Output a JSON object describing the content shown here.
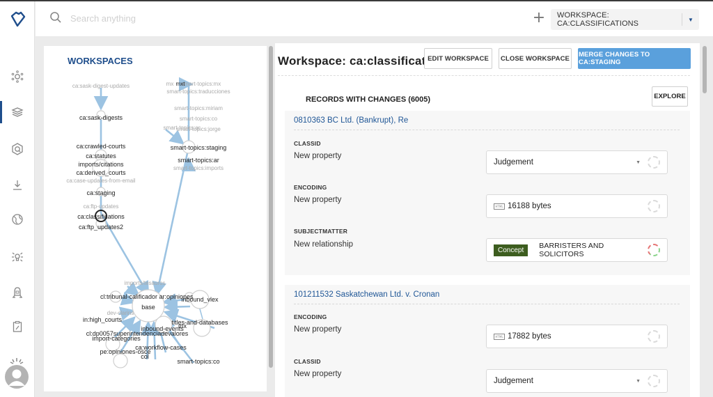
{
  "header": {
    "search_placeholder": "Search anything",
    "add_label": "+",
    "workspace_select": "WORKSPACE: CA:CLASSIFICATIONS"
  },
  "sidebar": {
    "items": [
      {
        "icon": "graph-nodes-icon",
        "active": false
      },
      {
        "icon": "layers-icon",
        "active": true
      },
      {
        "icon": "hexagon-search-icon",
        "active": false
      },
      {
        "icon": "download-icon",
        "active": false
      },
      {
        "icon": "globe-icon",
        "active": false
      },
      {
        "icon": "bulb-idea-icon",
        "active": false
      },
      {
        "icon": "robot-icon",
        "active": false
      },
      {
        "icon": "clipboard-edit-icon",
        "active": false
      }
    ]
  },
  "workspaces_panel": {
    "title": "WORKSPACES",
    "nodes": [
      {
        "label": "ca:sask-digest-updates",
        "muted": true
      },
      {
        "label": "ca:sask-digests",
        "muted": false
      },
      {
        "label": "ca:crawled-courts",
        "muted": false
      },
      {
        "label": "ca:statutes",
        "muted": false
      },
      {
        "label": "imports/citations",
        "muted": false
      },
      {
        "label": "ca:derived_courts",
        "muted": false
      },
      {
        "label": "ca:case-updates-from-email",
        "muted": true
      },
      {
        "label": "ca:staging",
        "muted": false
      },
      {
        "label": "ca:ftp-updates",
        "muted": true
      },
      {
        "label": "ca:classifications",
        "muted": false,
        "selected": true
      },
      {
        "label": "ca:ftp_updates2",
        "muted": false
      },
      {
        "label": "mx",
        "muted": true
      },
      {
        "label": "mxt",
        "muted": false
      },
      {
        "label": "smart-topics:mx",
        "muted": true
      },
      {
        "label": "smart-topics:traducciones",
        "muted": true
      },
      {
        "label": "smart-topics:miriam",
        "muted": true
      },
      {
        "label": "smart-topics:co",
        "muted": true
      },
      {
        "label": "smart-topics:ar",
        "muted": true
      },
      {
        "label": "smart-topics:jorge",
        "muted": true
      },
      {
        "label": "smart-topics:staging",
        "muted": false
      },
      {
        "label": "smart-topics:ar",
        "muted": false
      },
      {
        "label": "smart-topics:imports",
        "muted": true
      },
      {
        "label": "imports/tesauros",
        "muted": true
      },
      {
        "label": "cl:tribunal-calificador",
        "muted": false
      },
      {
        "label": "ar:opiniones",
        "muted": false
      },
      {
        "label": "inbound_vlex",
        "muted": false
      },
      {
        "label": "base",
        "muted": false
      },
      {
        "label": "dev-clarins",
        "muted": true
      },
      {
        "label": "in:high_courts",
        "muted": false
      },
      {
        "label": "titles-and-databases",
        "muted": false
      },
      {
        "label": "inbound-events",
        "muted": false
      },
      {
        "label": "cl:dp0057superintendenciadevalores",
        "muted": false
      },
      {
        "label": "import-categories",
        "muted": false
      },
      {
        "label": "mx",
        "muted": false
      },
      {
        "label": "ca:workflow-cases",
        "muted": false
      },
      {
        "label": "pe:opiniones-osce",
        "muted": false
      },
      {
        "label": "col",
        "muted": false
      },
      {
        "label": "smart-topics:co",
        "muted": false
      }
    ]
  },
  "workspace": {
    "title": "Workspace: ca:classificati",
    "edit_label": "EDIT WORKSPACE",
    "close_label": "CLOSE WORKSPACE",
    "merge_label": "MERGE CHANGES TO CA:STAGING",
    "records_title": "RECORDS WITH CHANGES (6005)",
    "explore_label": "EXPLORE",
    "records": [
      {
        "title": "0810363 BC Ltd. (Bankrupt), Re",
        "fields": [
          {
            "name": "CLASSID",
            "desc": "New property",
            "value": "Judgement",
            "type": "select"
          },
          {
            "name": "ENCODING",
            "desc": "New property",
            "value": "16188 bytes",
            "type": "html"
          },
          {
            "name": "SUBJECTMATTER",
            "desc": "New relationship",
            "badge": "Concept",
            "value": "BARRISTERS AND SOLICITORS",
            "type": "relation"
          }
        ]
      },
      {
        "title": "101211532 Saskatchewan Ltd. v. Cronan",
        "fields": [
          {
            "name": "ENCODING",
            "desc": "New property",
            "value": "17882 bytes",
            "type": "html"
          },
          {
            "name": "CLASSID",
            "desc": "New property",
            "value": "Judgement",
            "type": "select"
          }
        ]
      }
    ],
    "html_icon_text": "HTML"
  }
}
